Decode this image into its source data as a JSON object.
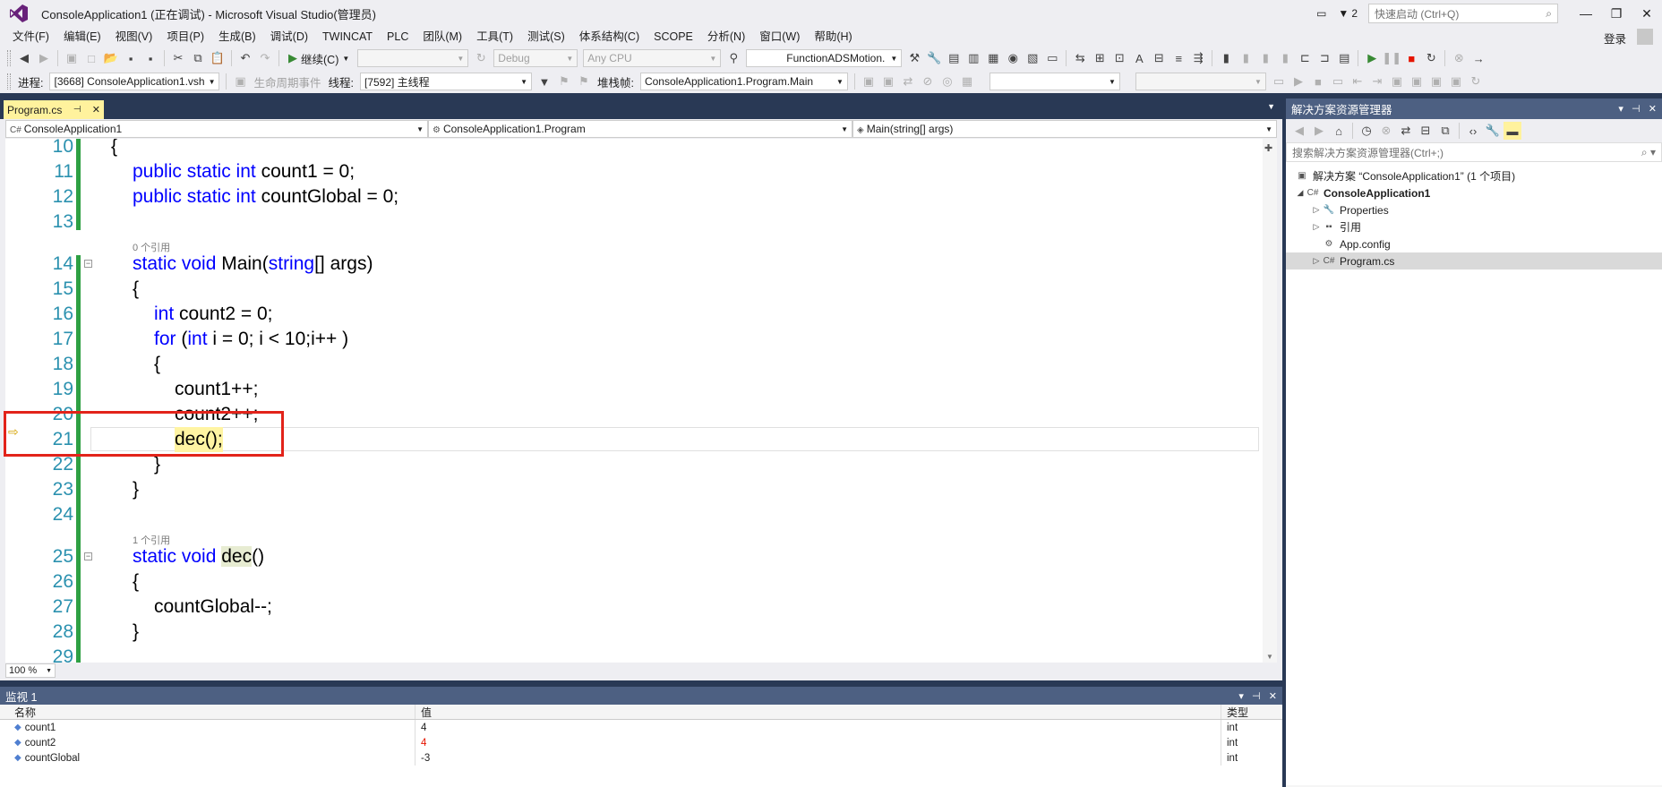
{
  "window": {
    "title": "ConsoleApplication1 (正在调试) - Microsoft Visual Studio(管理员)",
    "notification_count": "2",
    "quick_launch_placeholder": "快速启动 (Ctrl+Q)"
  },
  "menu": {
    "items": [
      "文件(F)",
      "编辑(E)",
      "视图(V)",
      "项目(P)",
      "生成(B)",
      "调试(D)",
      "TWINCAT",
      "PLC",
      "团队(M)",
      "工具(T)",
      "测试(S)",
      "体系结构(C)",
      "SCOPE",
      "分析(N)",
      "窗口(W)",
      "帮助(H)"
    ],
    "login": "登录"
  },
  "toolbar": {
    "continue_label": "继续(C)",
    "config": "Debug",
    "platform": "Any CPU",
    "function_dropdown": "FunctionADSMotion.",
    "process_label": "进程:",
    "process_value": "[3668] ConsoleApplication1.vsh",
    "lifecycle_label": "生命周期事件",
    "thread_label": "线程:",
    "thread_value": "[7592] 主线程",
    "stackframe_label": "堆栈帧:",
    "stackframe_value": "ConsoleApplication1.Program.Main"
  },
  "editor": {
    "tab_label": "Program.cs",
    "nav_project": "ConsoleApplication1",
    "nav_class": "ConsoleApplication1.Program",
    "nav_member": "Main(string[] args)",
    "zoom": "100 %",
    "ref_main": "0 个引用",
    "ref_dec": "1 个引用",
    "lines": {
      "n10": "10",
      "n11": "11",
      "n12": "12",
      "n13": "13",
      "n14": "14",
      "n15": "15",
      "n16": "16",
      "n17": "17",
      "n18": "18",
      "n19": "19",
      "n20": "20",
      "n21": "21",
      "n22": "22",
      "n23": "23",
      "n24": "24",
      "n25": "25",
      "n26": "26",
      "n27": "27",
      "n28": "28",
      "n29": "29"
    },
    "code": {
      "l10": "{",
      "l11_kw": "public static int",
      "l11_rest": " count1 = 0;",
      "l12_kw": "public static int",
      "l12_rest": " countGlobal = 0;",
      "l14_kw": "static void",
      "l14_name": " Main(",
      "l14_kw2": "string",
      "l14_rest": "[] args)",
      "l15": "{",
      "l16_kw": "int",
      "l16_rest": " count2 = 0;",
      "l17_kw": "for",
      "l17_a": " (",
      "l17_kw2": "int",
      "l17_rest": " i = 0; i < 10;i++ )",
      "l18": "{",
      "l19": "count1++;",
      "l20": "count2++;",
      "l21": "dec();",
      "l22": "}",
      "l23": "}",
      "l25_kw": "static void",
      "l25_sp": " ",
      "l25_name": "dec",
      "l25_rest": "()",
      "l26": "{",
      "l27": "countGlobal--;",
      "l28": "}"
    }
  },
  "watch": {
    "title": "监视 1",
    "col_name": "名称",
    "col_value": "值",
    "col_type": "类型",
    "rows": [
      {
        "name": "count1",
        "value": "4",
        "type": "int"
      },
      {
        "name": "count2",
        "value": "4",
        "type": "int"
      },
      {
        "name": "countGlobal",
        "value": "-3",
        "type": "int"
      }
    ]
  },
  "solution": {
    "title": "解决方案资源管理器",
    "search_placeholder": "搜索解决方案资源管理器(Ctrl+;)",
    "solution_label": "解决方案 “ConsoleApplication1” (1 个项目)",
    "project": "ConsoleApplication1",
    "items": [
      "Properties",
      "引用",
      "App.config",
      "Program.cs"
    ]
  },
  "colors": {
    "keyword": "#0000ff",
    "line_number": "#2b91af",
    "tab_active": "#fff29d",
    "panel_title": "#4d6082",
    "highlight_box": "#e2231a",
    "changed_value": "#e51400"
  }
}
